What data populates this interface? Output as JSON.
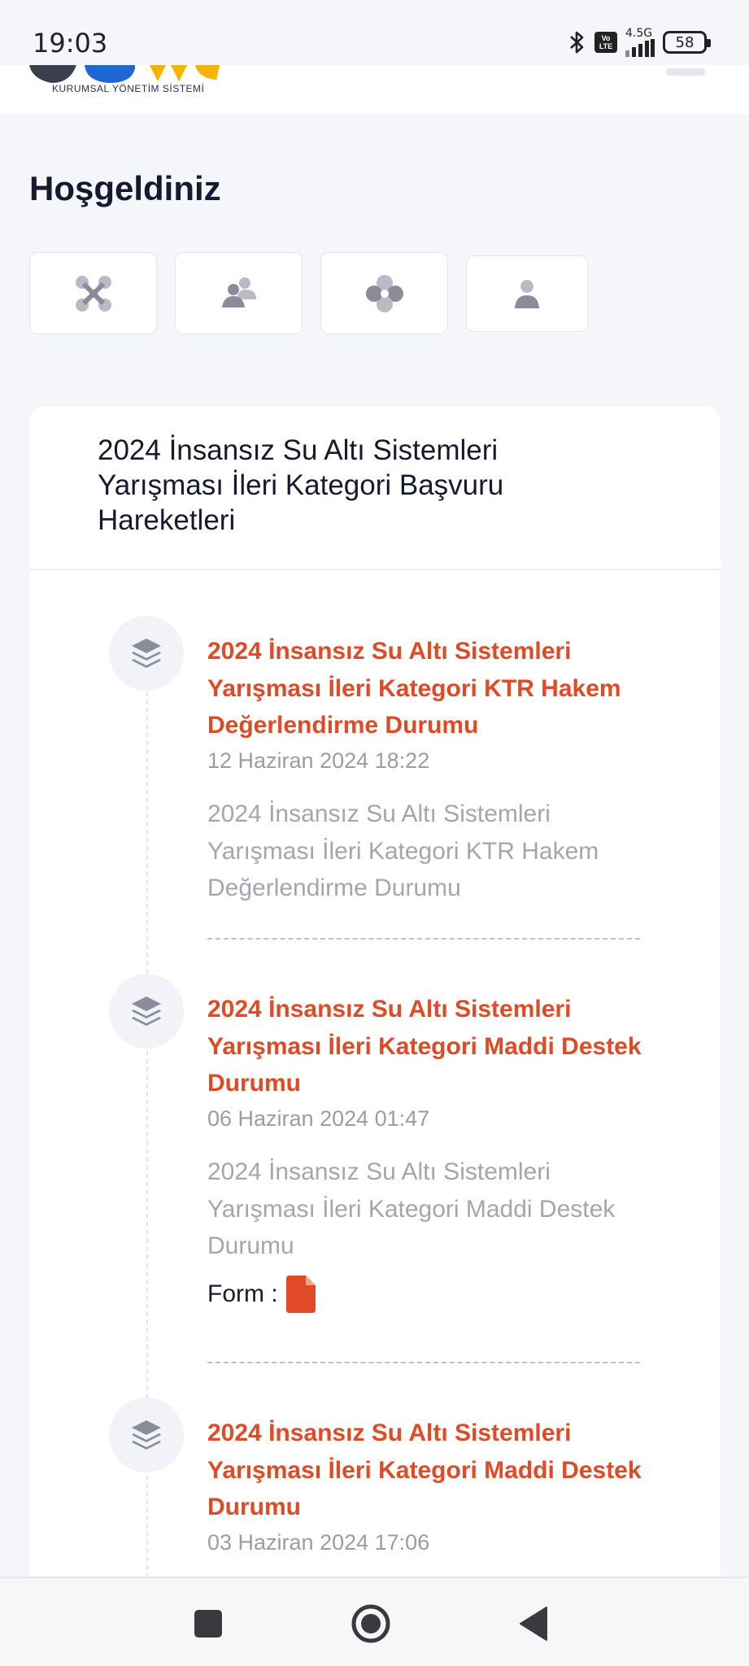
{
  "status_bar": {
    "time": "19:03",
    "network": "4.5G",
    "volte": "Vo LTE",
    "battery": "58"
  },
  "header": {
    "logo_text": "KURUMSAL YÖNETİM SİSTEMİ"
  },
  "welcome_title": "Hoşgeldiniz",
  "quick_actions": [
    {
      "icon": "drone-icon"
    },
    {
      "icon": "team-icon"
    },
    {
      "icon": "fan-icon"
    },
    {
      "icon": "user-icon"
    }
  ],
  "card": {
    "title": "2024 İnsansız Su Altı Sistemleri Yarışması İleri Kategori Başvuru Hareketleri",
    "timeline": [
      {
        "title": "2024 İnsansız Su Altı Sistemleri Yarışması İleri Kategori KTR Hakem Değerlendirme Durumu",
        "date": "12 Haziran 2024 18:22",
        "description": "2024 İnsansız Su Altı Sistemleri Yarışması İleri Kategori KTR Hakem Değerlendirme Durumu"
      },
      {
        "title": "2024 İnsansız Su Altı Sistemleri Yarışması İleri Kategori Maddi Destek Durumu",
        "date": "06 Haziran 2024 01:47",
        "description": "2024 İnsansız Su Altı Sistemleri Yarışması İleri Kategori Maddi Destek Durumu",
        "form_label": "Form :"
      },
      {
        "title": "2024 İnsansız Su Altı Sistemleri Yarışması İleri Kategori Maddi Destek Durumu",
        "date": "03 Haziran 2024 17:06"
      }
    ]
  },
  "colors": {
    "accent": "#e04a25",
    "page_bg": "#f5f6fa",
    "card_bg": "#ffffff"
  }
}
